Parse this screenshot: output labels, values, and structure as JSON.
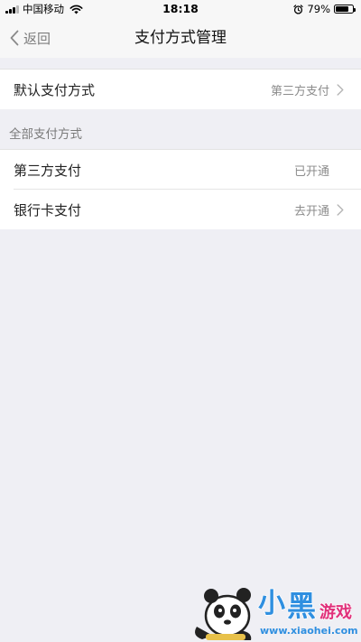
{
  "status_bar": {
    "carrier": "中国移动",
    "time": "18:18",
    "battery_percent": "79%",
    "battery_level": 0.79,
    "icons": [
      "signal-icon",
      "wifi-icon",
      "alarm-icon",
      "battery-icon"
    ]
  },
  "nav": {
    "back_label": "返回",
    "title": "支付方式管理"
  },
  "default_payment": {
    "label": "默认支付方式",
    "value": "第三方支付"
  },
  "all_methods": {
    "header": "全部支付方式",
    "items": [
      {
        "label": "第三方支付",
        "status": "已开通",
        "has_chevron": false
      },
      {
        "label": "银行卡支付",
        "status": "去开通",
        "has_chevron": true
      }
    ]
  },
  "watermark": {
    "text": "小黑游戏",
    "url": "www.xiaohei.com"
  },
  "colors": {
    "background": "#efeff4",
    "row_background": "#ffffff",
    "watermark_blue": "#2f8fe0",
    "watermark_pink": "#e0307a"
  }
}
